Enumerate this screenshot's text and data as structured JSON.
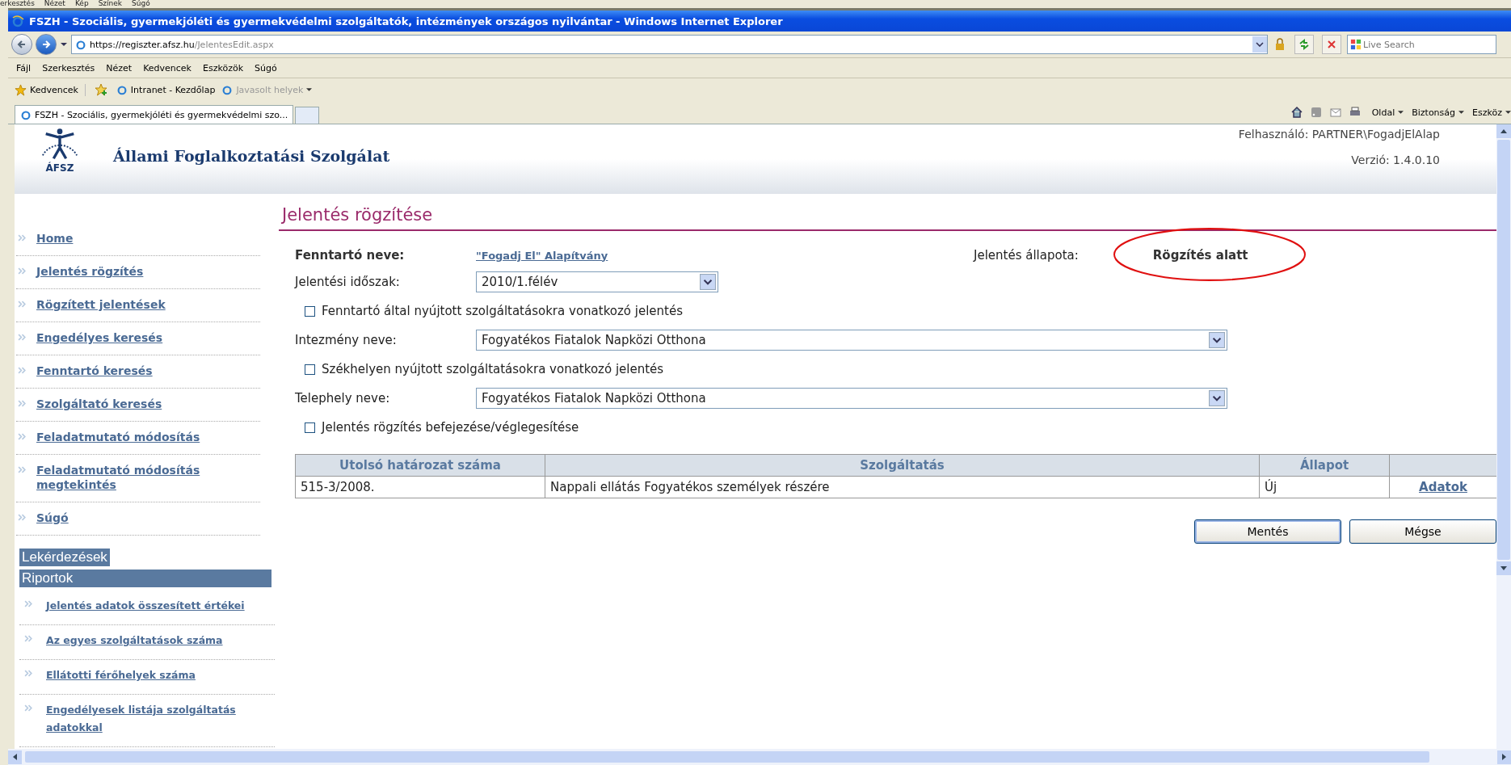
{
  "background_window_menu": [
    "erkesztés",
    "Nézet",
    "Kép",
    "Színek",
    "Súgó"
  ],
  "window": {
    "title": "FSZH - Szociális, gyermekjóléti és gyermekvédelmi szolgáltatók, intézmények országos nyilvántar - Windows Internet Explorer"
  },
  "address_bar": {
    "url_host": "https://regiszter.afsz.hu",
    "url_path": "/JelentesEdit.aspx"
  },
  "search": {
    "placeholder": "Live Search"
  },
  "menu": [
    "Fájl",
    "Szerkesztés",
    "Nézet",
    "Kedvencek",
    "Eszközök",
    "Súgó"
  ],
  "favorites_bar": {
    "favorites": "Kedvencek",
    "links": [
      {
        "label": "Intranet - Kezdőlap",
        "disabled": false
      },
      {
        "label": "Javasolt helyek",
        "disabled": true
      }
    ]
  },
  "tabs": [
    {
      "label": "FSZH - Szociális, gyermekjóléti és gyermekvédelmi szo...",
      "selected": true
    }
  ],
  "command_bar": [
    "Oldal",
    "Biztonság",
    "Eszköz"
  ],
  "header": {
    "org_name": "Állami Foglalkoztatási Szolgálat",
    "logo_text": "ÁFSZ",
    "user": "Felhasználó: PARTNER\\FogadjElAlap",
    "version": "Verzió: 1.4.0.10"
  },
  "sidebar": {
    "items": [
      "Home",
      "Jelentés rögzítés",
      "Rögzített jelentések",
      "Engedélyes keresés",
      "Fenntartó keresés",
      "Szolgáltató keresés",
      "Feladatmutató módosítás",
      "Feladatmutató módosítás megtekintés",
      "Súgó"
    ],
    "sections": [
      {
        "title": "Lekérdezések"
      },
      {
        "title": "Riportok",
        "items": [
          "Jelentés adatok összesített értékei",
          "Az egyes szolgáltatások száma",
          "Ellátotti férőhelyek száma",
          "Engedélyesek listája szolgáltatás adatokkal"
        ]
      }
    ]
  },
  "page_title": "Jelentés rögzítése",
  "form": {
    "maintainer_label": "Fenntartó neve:",
    "maintainer_link": "\"Fogadj El\" Alapítvány",
    "status_label": "Jelentés állapota:",
    "status_value": "Rögzítés alatt",
    "status_highlighted": true,
    "rows": [
      {
        "kind": "select",
        "label": "Jelentési időszak:",
        "value": "2010/1.félév",
        "wide": false
      },
      {
        "kind": "checkbox",
        "label": "Fenntartó által nyújtott szolgáltatásokra vonatkozó jelentés",
        "checked": false
      },
      {
        "kind": "select",
        "label": "Intezmény neve:",
        "value": "Fogyatékos Fiatalok Napközi Otthona",
        "wide": true
      },
      {
        "kind": "checkbox",
        "label": "Székhelyen nyújtott szolgáltatásokra vonatkozó jelentés",
        "checked": false
      },
      {
        "kind": "select",
        "label": "Telephely neve:",
        "value": "Fogyatékos Fiatalok Napközi Otthona",
        "wide": true
      },
      {
        "kind": "checkbox",
        "label": "Jelentés rögzítés befejezése/véglegesítése",
        "checked": false
      }
    ]
  },
  "table": {
    "columns": [
      "Utolsó határozat száma",
      "Szolgáltatás",
      "Állapot"
    ],
    "rows": [
      {
        "number": "515-3/2008.",
        "service": "Nappali ellátás Fogyatékos személyek részére",
        "status": "Új",
        "action": "Adatok"
      }
    ]
  },
  "buttons": [
    "Mentés",
    "Mégse"
  ]
}
